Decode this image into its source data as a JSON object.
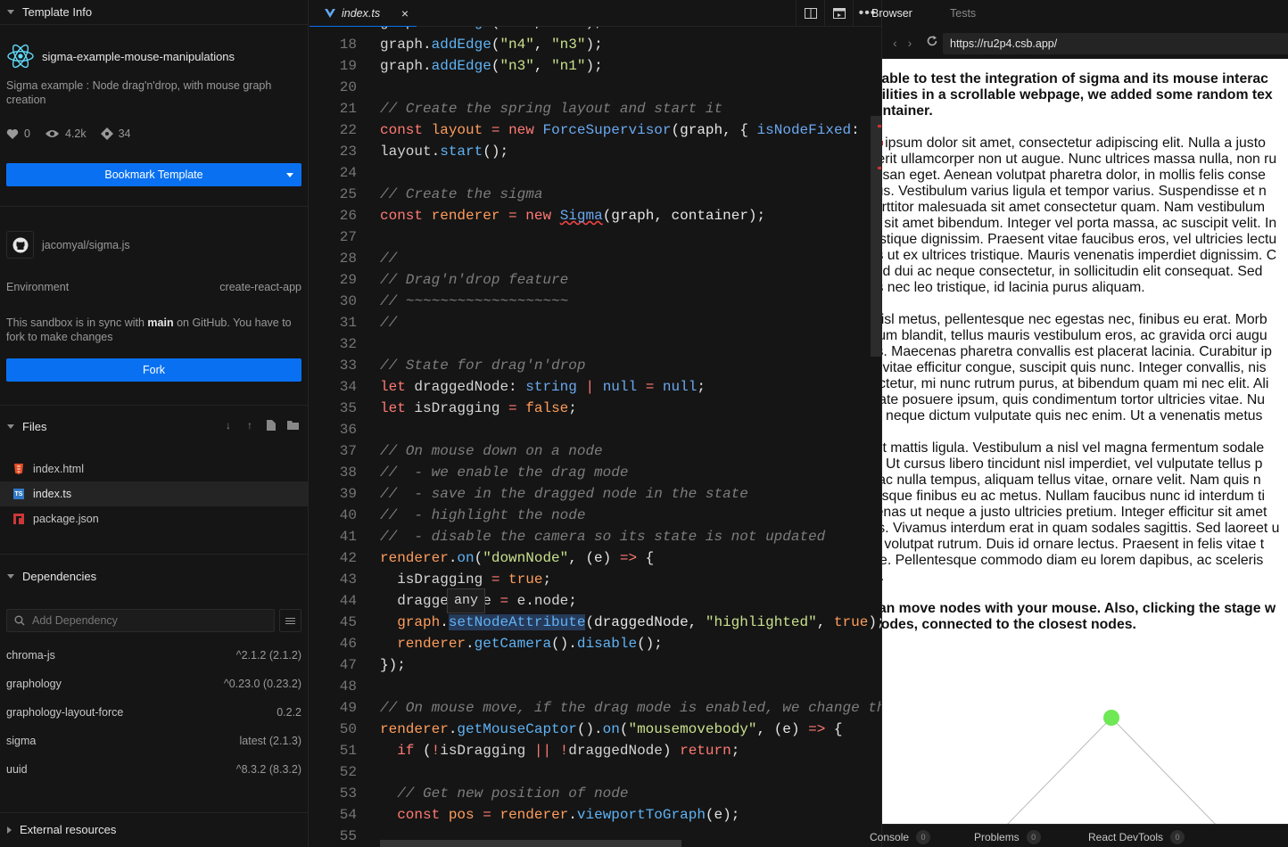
{
  "sidebar": {
    "template_info": {
      "header": "Template Info",
      "name": "sigma-example-mouse-manipulations",
      "description": "Sigma example : Node drag'n'drop, with mouse graph creation",
      "likes": "0",
      "views": "4.2k",
      "forks": "34",
      "bookmark_label": "Bookmark Template",
      "repo": "jacomyal/sigma.js",
      "environment_label": "Environment",
      "environment_value": "create-react-app",
      "sync_pre": "This sandbox is in sync with ",
      "sync_branch": "main",
      "sync_post": " on GitHub. You have to fork to make changes",
      "fork_label": "Fork"
    },
    "files": {
      "header": "Files",
      "items": [
        {
          "name": "index.html",
          "type": "html"
        },
        {
          "name": "index.ts",
          "type": "ts"
        },
        {
          "name": "package.json",
          "type": "json"
        }
      ]
    },
    "dependencies": {
      "header": "Dependencies",
      "search_placeholder": "Add Dependency",
      "items": [
        {
          "name": "chroma-js",
          "version": "^2.1.2 (2.1.2)"
        },
        {
          "name": "graphology",
          "version": "^0.23.0 (0.23.2)"
        },
        {
          "name": "graphology-layout-force",
          "version": "0.2.2"
        },
        {
          "name": "sigma",
          "version": "latest (2.1.3)"
        },
        {
          "name": "uuid",
          "version": "^8.3.2 (8.3.2)"
        }
      ]
    },
    "external": {
      "header": "External resources"
    }
  },
  "editor": {
    "tab_label": "index.ts",
    "tooltip": "any",
    "line_numbers": [
      "18",
      "19",
      "20",
      "21",
      "22",
      "23",
      "24",
      "25",
      "26",
      "27",
      "28",
      "29",
      "30",
      "31",
      "32",
      "33",
      "34",
      "35",
      "36",
      "37",
      "38",
      "39",
      "40",
      "41",
      "42",
      "43",
      "44",
      "45",
      "46",
      "47",
      "48",
      "49",
      "50",
      "51",
      "52",
      "53",
      "54",
      "55"
    ]
  },
  "browser": {
    "tab_browser": "Browser",
    "tab_tests": "Tests",
    "url": "https://ru2p4.csb.app/",
    "paragraphs": [
      {
        "bold": true,
        "lines": [
          "To be able to test the integration of sigma and its mouse interac",
          "capabilities in a scrollable webpage, we added some random tex",
          "the container."
        ]
      },
      {
        "bold": false,
        "lines": [
          "Lorem ipsum dolor sit amet, consectetur adipiscing elit. Nulla a justo",
          "hendrerit ullamcorper non ut augue. Nunc ultrices massa nulla, non ru",
          "accumsan eget. Aenean volutpat pharetra dolor, in mollis felis conse",
          "dapibus. Vestibulum varius ligula et tempor varius. Suspendisse et n",
          "nisi porttitor malesuada sit amet consectetur quam. Nam vestibulum",
          "dolore sit amet bibendum. Integer vel porta massa, ac suscipit velit. In",
          "sed tristique dignissim. Praesent vitae faucibus eros, vel ultricies lectu",
          "Mauris ut ex ultrices tristique. Mauris venenatis imperdiet dignissim. C",
          "eleifend dui ac neque consectetur, in sollicitudin elit consequat. Sed",
          "mauris nec leo tristique, id lacinia purus aliquam."
        ]
      },
      {
        "bold": false,
        "lines": [
          "Duis nisl metus, pellentesque nec egestas nec, finibus eu erat. Morb",
          "ut rutrum blandit, tellus mauris vestibulum eros, ac gravida orci augu",
          "mauris. Maecenas pharetra convallis est placerat lacinia. Curabitur ip",
          "mattis vitae efficitur congue, suscipit quis nunc. Integer convallis, nis",
          "consectetur, mi nunc rutrum purus, at bibendum quam mi nec elit. Ali",
          "vulputate posuere ipsum, quis condimentum tortor ultricies vitae. Nu",
          "quis id neque dictum vulputate quis nec enim. Ut a venenatis metus"
        ]
      },
      {
        "bold": false,
        "lines": [
          "Nam ut mattis ligula. Vestibulum a nisl vel magna fermentum sodale",
          "lectus. Ut cursus libero tincidunt nisl imperdiet, vel vulputate tellus p",
          "Nunc ac nulla tempus, aliquam tellus vitae, ornare velit. Nam quis n",
          "scelerisque finibus eu ac metus. Nullam faucibus nunc id interdum ti",
          "Maecenas ut neque a justo ultricies pretium. Integer efficitur sit amet",
          "sagittis. Vivamus interdum erat in quam sodales sagittis. Sed laoreet u",
          "neque volutpat rutrum. Duis id ornare lectus. Praesent in felis vitae t",
          "congue. Pellentesque commodo diam eu lorem dapibus, ac sceleris",
          "neque."
        ]
      },
      {
        "bold": true,
        "lines": [
          "You can move nodes with your mouse. Also, clicking the stage w",
          "new nodes, connected to the closest nodes."
        ]
      }
    ],
    "node_color": "#6ee855",
    "bottom": {
      "console": "Console",
      "console_count": "0",
      "problems": "Problems",
      "problems_count": "0",
      "devtools": "React DevTools",
      "devtools_count": "0"
    }
  },
  "colors": {
    "accent": "#0971f1",
    "keyword": "#ff7a72",
    "string": "#c8e08c",
    "function": "#5fb3f5",
    "comment": "#7d7d7d"
  }
}
